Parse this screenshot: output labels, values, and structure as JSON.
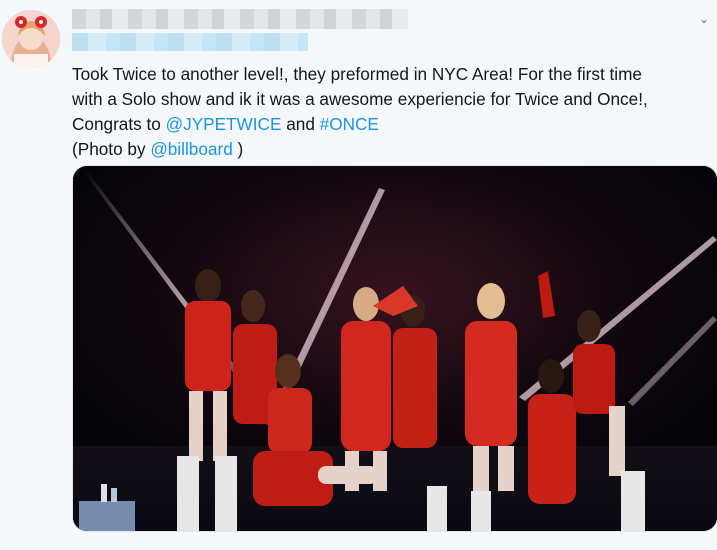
{
  "tweet": {
    "menu_icon_glyph": "⌄",
    "text_lines": {
      "line1": "Took Twice to another level!, they preformed in NYC Area! For the first time",
      "line2": "with a Solo show and ik it was a awesome experiencie for Twice and Once!,",
      "line3_prefix": "Congrats to ",
      "mention_jyp": "@JYPETWICE",
      "line3_mid": " and ",
      "hashtag_once": "#ONCE",
      "line4_prefix": "(Photo by ",
      "mention_billboard": "@billboard",
      "line4_suffix": " )"
    },
    "colors": {
      "link": "#1b95e0",
      "text": "#14171a",
      "background": "#f5f8fa"
    }
  },
  "media": {
    "icon": "concert-photo",
    "performer_count": 9,
    "costume_color": "#d7261c"
  }
}
